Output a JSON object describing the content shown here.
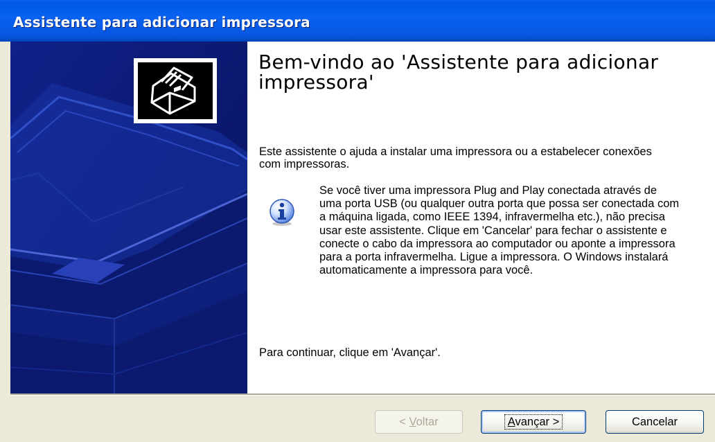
{
  "window": {
    "title": "Assistente para adicionar impressora"
  },
  "main": {
    "heading": "Bem-vindo ao 'Assistente para adicionar impressora'",
    "intro": "Este assistente o ajuda a instalar uma impressora ou a estabelecer conexões com impressoras.",
    "info_text": "Se você tiver uma impressora Plug and Play conectada através de uma porta USB (ou qualquer outra porta que possa ser conectada com a máquina ligada, como IEEE 1394, infravermelha etc.), não precisa usar este assistente. Clique em 'Cancelar' para fechar o assistente e conecte o cabo da impressora ao computador ou aponte a impressora para a porta infravermelha. Ligue a impressora. O Windows instalará automaticamente a impressora para você.",
    "continue_text": "Para continuar, clique em 'Avançar'."
  },
  "buttons": {
    "back": {
      "prefix": "< ",
      "accel": "V",
      "rest": "oltar",
      "enabled": false
    },
    "next": {
      "accel": "A",
      "rest": "vançar >",
      "enabled": true
    },
    "cancel": {
      "label": "Cancelar",
      "enabled": true
    }
  },
  "icons": {
    "header": "printer-icon",
    "info": "info-icon"
  },
  "colors": {
    "titlebar": "#0058e6",
    "left_panel": "#0a1a78",
    "dialog_face": "#ece9d8",
    "disabled_text": "#aca899"
  }
}
